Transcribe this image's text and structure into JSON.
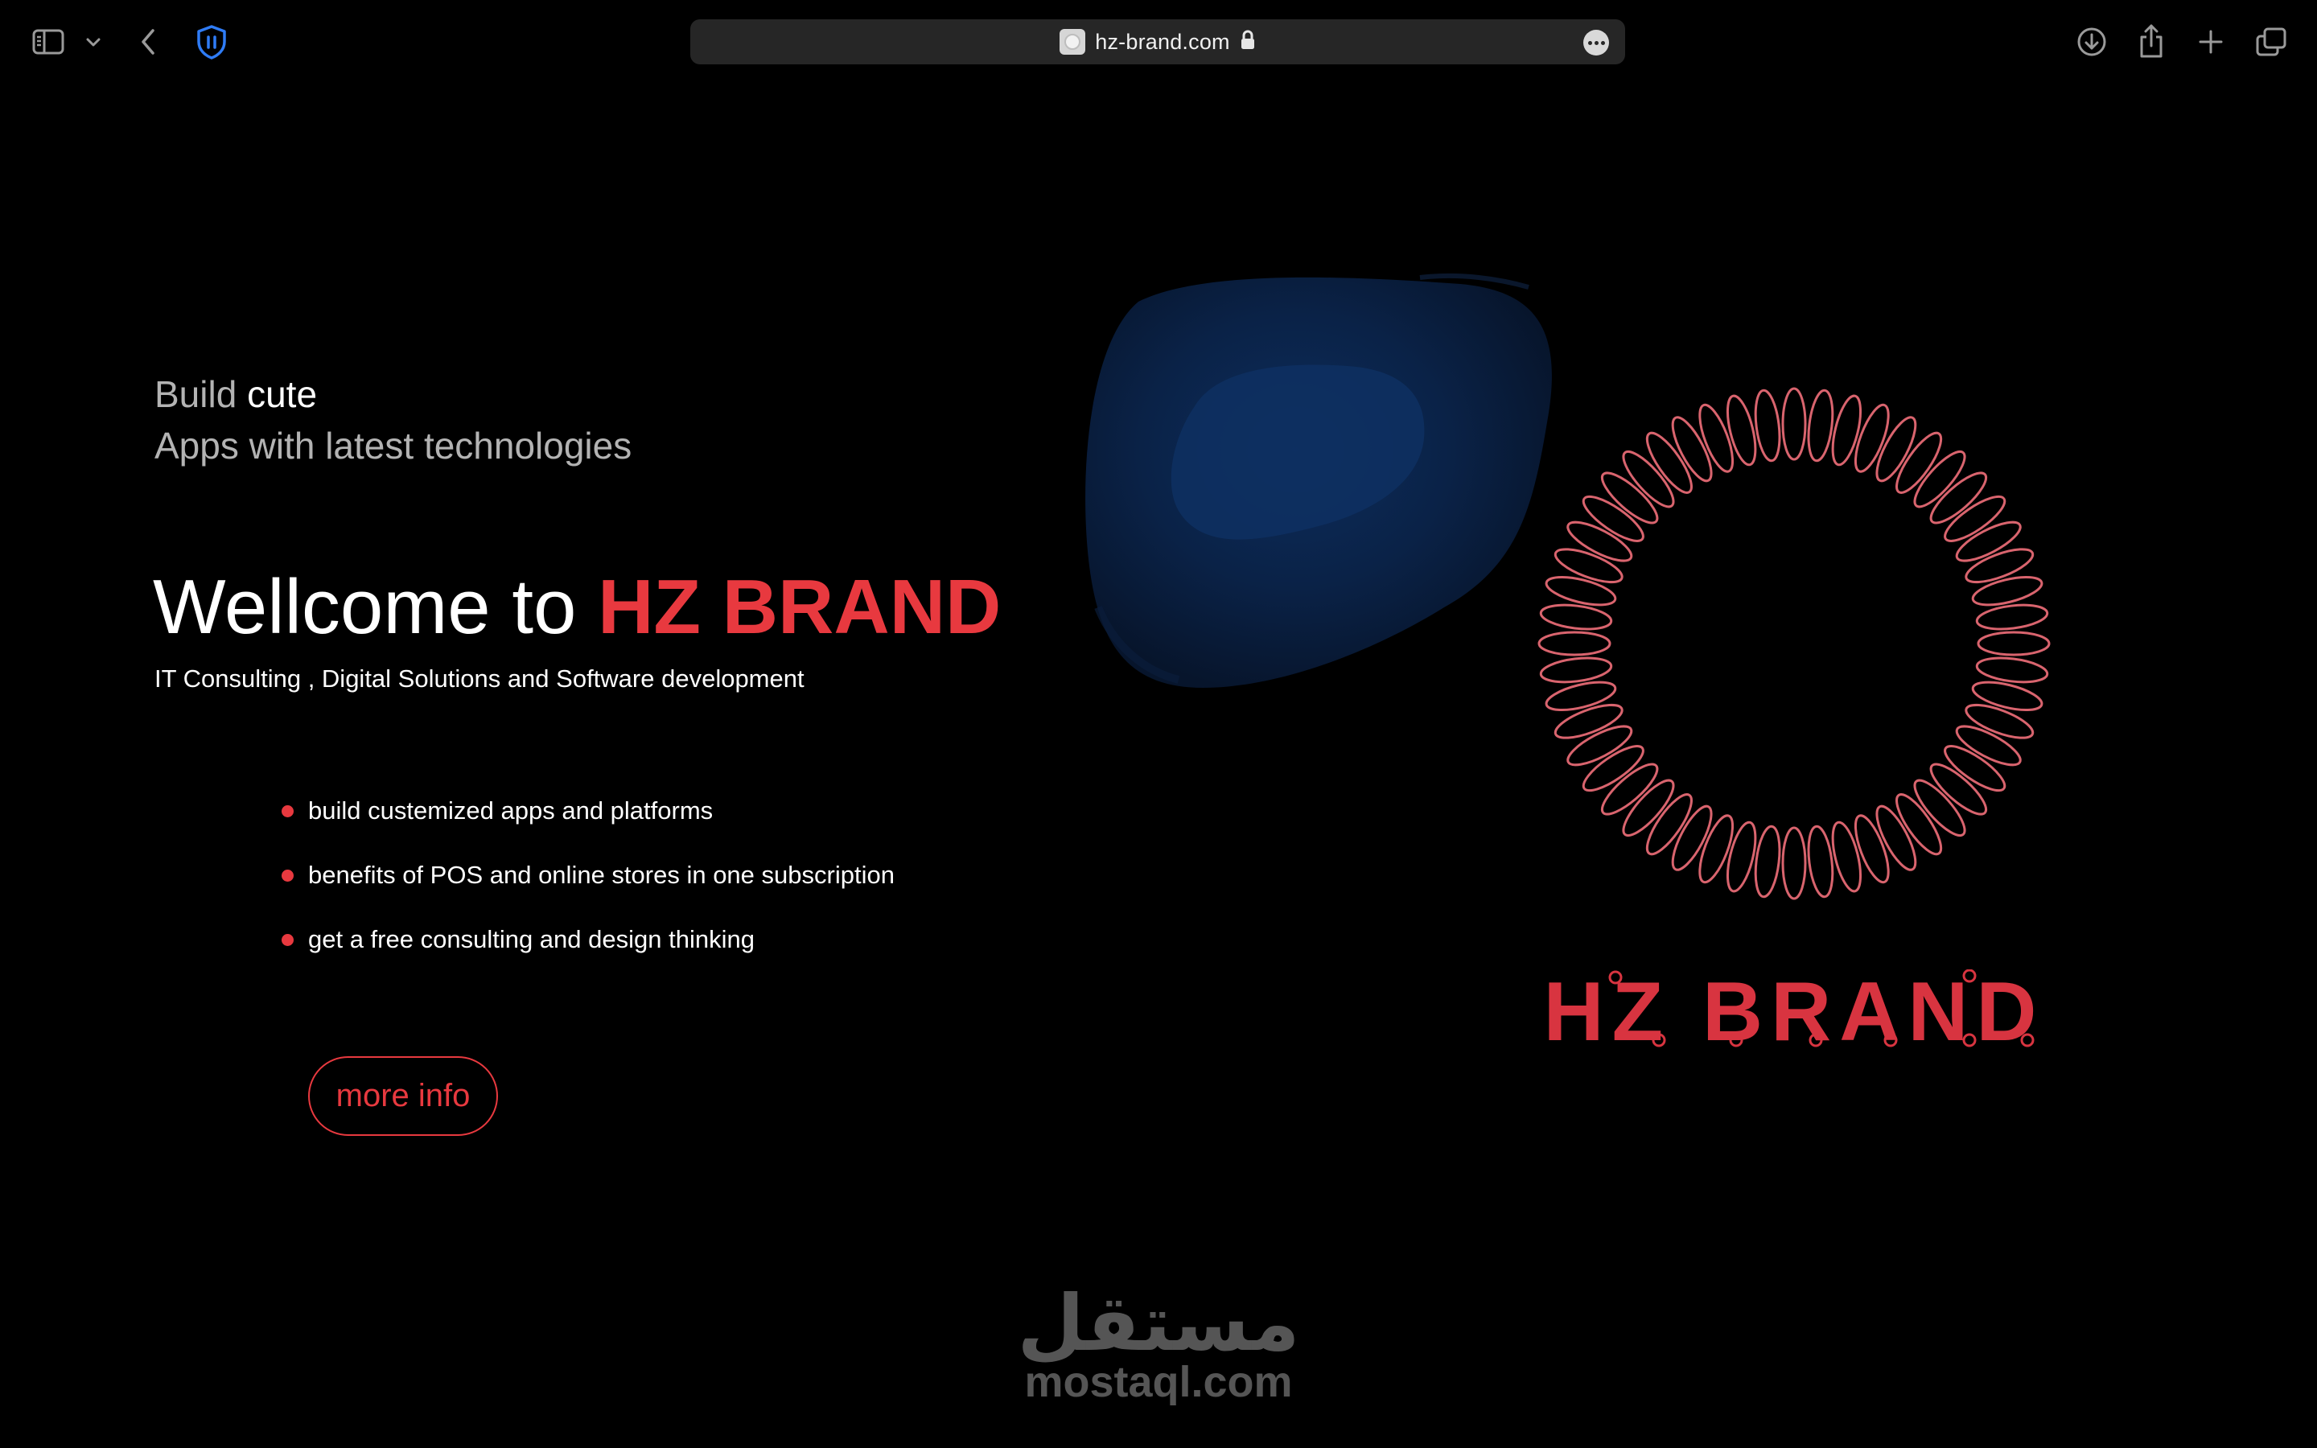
{
  "browser": {
    "url": "hz-brand.com",
    "icons": {
      "sidebar": "sidebar-icon",
      "sidebar_menu": "chevron-down-icon",
      "back": "chevron-left-icon",
      "privacy": "shield-icon",
      "secure": "lock-icon",
      "page_menu": "more-icon",
      "download": "download-icon",
      "share": "share-icon",
      "new_tab": "plus-icon",
      "tabs": "tab-overview-icon"
    }
  },
  "hero": {
    "tagline_prefix": "Build",
    "tagline_highlight": "cute",
    "tagline_line2": "Apps with latest technologies",
    "welcome_prefix": "Wellcome to",
    "welcome_brand": "HZ BRAND",
    "subtitle": "IT Consulting , Digital Solutions and Software development",
    "features": [
      "build custemized apps and platforms",
      "benefits of POS and online stores in one subscription",
      "get a free consulting and design thinking"
    ],
    "cta_label": "more info"
  },
  "logo": {
    "text": "HZ BRAND"
  },
  "watermark": {
    "arabic": "مستقل",
    "latin": "mostaql.com"
  },
  "colors": {
    "accent": "#e8393f",
    "ring": "#d9646e",
    "blob": "#0b2a55",
    "background": "#000000"
  }
}
